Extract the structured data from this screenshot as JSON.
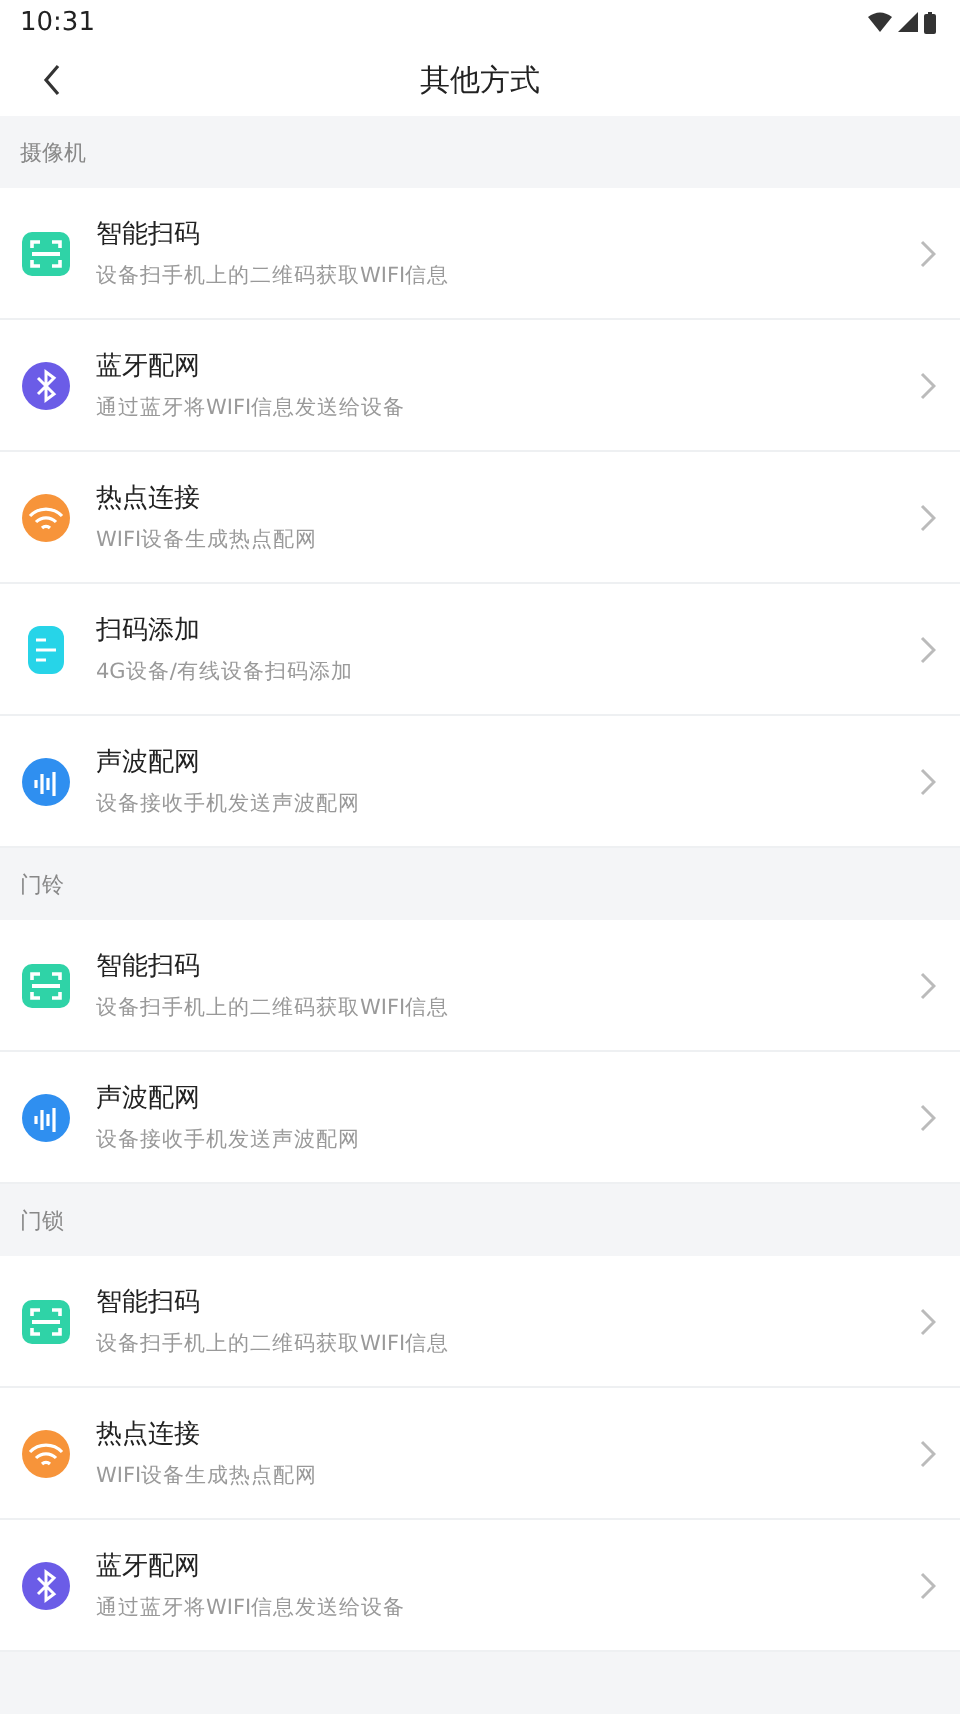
{
  "status_bar": {
    "time": "10:31"
  },
  "header": {
    "title": "其他方式"
  },
  "sections": [
    {
      "title": "摄像机",
      "items": [
        {
          "kind": "scan",
          "title": "智能扫码",
          "subtitle": "设备扫手机上的二维码获取WIFI信息"
        },
        {
          "kind": "bluetooth",
          "title": "蓝牙配网",
          "subtitle": "通过蓝牙将WIFI信息发送给设备"
        },
        {
          "kind": "hotspot",
          "title": "热点连接",
          "subtitle": "WIFI设备生成热点配网"
        },
        {
          "kind": "scanadd",
          "title": "扫码添加",
          "subtitle": "4G设备/有线设备扫码添加"
        },
        {
          "kind": "sound",
          "title": "声波配网",
          "subtitle": "设备接收手机发送声波配网"
        }
      ]
    },
    {
      "title": "门铃",
      "items": [
        {
          "kind": "scan",
          "title": "智能扫码",
          "subtitle": "设备扫手机上的二维码获取WIFI信息"
        },
        {
          "kind": "sound",
          "title": "声波配网",
          "subtitle": "设备接收手机发送声波配网"
        }
      ]
    },
    {
      "title": "门锁",
      "items": [
        {
          "kind": "scan",
          "title": "智能扫码",
          "subtitle": "设备扫手机上的二维码获取WIFI信息"
        },
        {
          "kind": "hotspot",
          "title": "热点连接",
          "subtitle": "WIFI设备生成热点配网"
        },
        {
          "kind": "bluetooth",
          "title": "蓝牙配网",
          "subtitle": "通过蓝牙将WIFI信息发送给设备"
        }
      ]
    }
  ]
}
